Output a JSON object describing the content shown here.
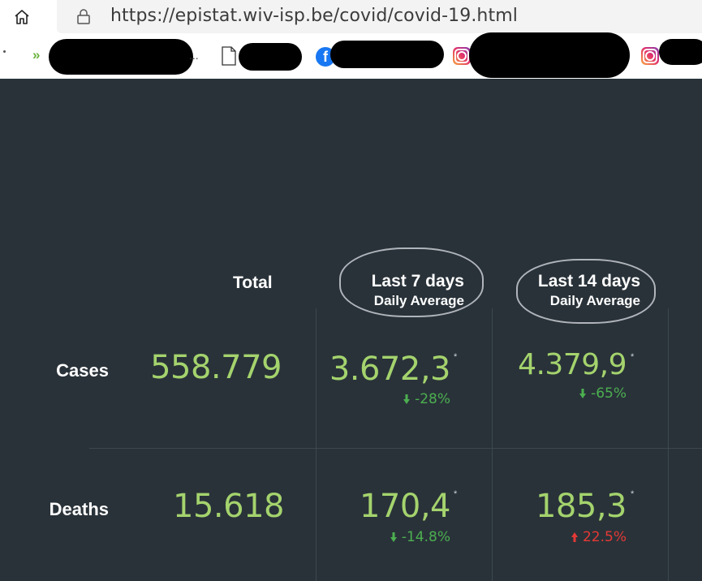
{
  "browser": {
    "url": "https://epistat.wiv-isp.be/covid/covid-19.html",
    "icons": [
      "home-icon",
      "lock-icon",
      "page-icon",
      "facebook-icon",
      "instagram-icon"
    ],
    "bookmark_ellipsis": "..."
  },
  "table": {
    "headers": {
      "total": "Total",
      "last7_main": "Last 7 days",
      "last7_sub": "Daily Average",
      "last14_main": "Last 14 days",
      "last14_sub": "Daily Average"
    },
    "rows": [
      {
        "label": "Cases",
        "total": "558.779",
        "last7": "3.672,3",
        "last7_change": "-28%",
        "last7_dir": "down",
        "last14": "4.379,9",
        "last14_change": "-65%",
        "last14_dir": "down"
      },
      {
        "label": "Deaths",
        "total": "15.618",
        "last7": "170,4",
        "last7_change": "-14.8%",
        "last7_dir": "down",
        "last14": "185,3",
        "last14_change": "22.5%",
        "last14_dir": "up"
      }
    ],
    "footnote_mark": "*"
  },
  "colors": {
    "background": "#293239",
    "value_green": "#a4d36d",
    "change_down": "#4caf50",
    "change_up": "#e53935"
  }
}
